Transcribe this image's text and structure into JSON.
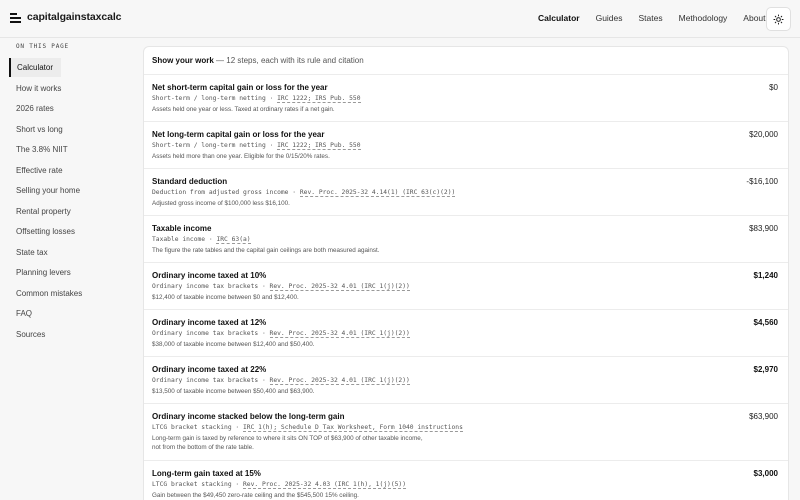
{
  "header": {
    "brand": "capitalgainstaxcalc",
    "nav": [
      "Calculator",
      "Guides",
      "States",
      "Methodology",
      "About"
    ]
  },
  "sidebar": {
    "heading": "ON THIS PAGE",
    "items": [
      "Calculator",
      "How it works",
      "2026 rates",
      "Short vs long",
      "The 3.8% NIIT",
      "Effective rate",
      "Selling your home",
      "Rental property",
      "Offsetting losses",
      "State tax",
      "Planning levers",
      "Common mistakes",
      "FAQ",
      "Sources"
    ]
  },
  "card": {
    "title": "Show your work",
    "subtitle": "— 12 steps, each with its rule and citation",
    "steps": [
      {
        "title": "Net short-term capital gain or loss for the year",
        "value": "$0",
        "rule": "Short-term / long-term netting",
        "cite": "IRC 1222; IRS Pub. 550",
        "note": "Assets held one year or less. Taxed at ordinary rates if a net gain."
      },
      {
        "title": "Net long-term capital gain or loss for the year",
        "value": "$20,000",
        "rule": "Short-term / long-term netting",
        "cite": "IRC 1222; IRS Pub. 550",
        "note": "Assets held more than one year. Eligible for the 0/15/20% rates."
      },
      {
        "title": "Standard deduction",
        "value": "-$16,100",
        "rule": "Deduction from adjusted gross income",
        "cite": "Rev. Proc. 2025-32 4.14(1) (IRC 63(c)(2))",
        "note": "Adjusted gross income of $100,000 less $16,100."
      },
      {
        "title": "Taxable income",
        "value": "$83,900",
        "rule": "Taxable income",
        "cite": "IRC 63(a)",
        "note": "The figure the rate tables and the capital gain ceilings are both measured against."
      },
      {
        "title": "Ordinary income taxed at 10%",
        "value": "$1,240",
        "rule": "Ordinary income tax brackets",
        "cite": "Rev. Proc. 2025-32 4.01 (IRC 1(j)(2))",
        "note": "$12,400 of taxable income between $0 and $12,400."
      },
      {
        "title": "Ordinary income taxed at 12%",
        "value": "$4,560",
        "rule": "Ordinary income tax brackets",
        "cite": "Rev. Proc. 2025-32 4.01 (IRC 1(j)(2))",
        "note": "$38,000 of taxable income between $12,400 and $50,400."
      },
      {
        "title": "Ordinary income taxed at 22%",
        "value": "$2,970",
        "rule": "Ordinary income tax brackets",
        "cite": "Rev. Proc. 2025-32 4.01 (IRC 1(j)(2))",
        "note": "$13,500 of taxable income between $50,400 and $63,900."
      },
      {
        "title": "Ordinary income stacked below the long-term gain",
        "value": "$63,900",
        "rule": "LTCG bracket stacking",
        "cite": "IRC 1(h); Schedule D Tax Worksheet, Form 1040 instructions",
        "note": "Long-term gain is taxed by reference to where it sits ON TOP of $63,900 of other taxable income, not from the bottom of the rate table."
      },
      {
        "title": "Long-term gain taxed at 15%",
        "value": "$3,000",
        "rule": "LTCG bracket stacking",
        "cite": "Rev. Proc. 2025-32 4.03 (IRC 1(h), 1(j)(5))",
        "note": "Gain between the $49,450 zero-rate ceiling and the $545,500 15% ceiling."
      }
    ]
  }
}
